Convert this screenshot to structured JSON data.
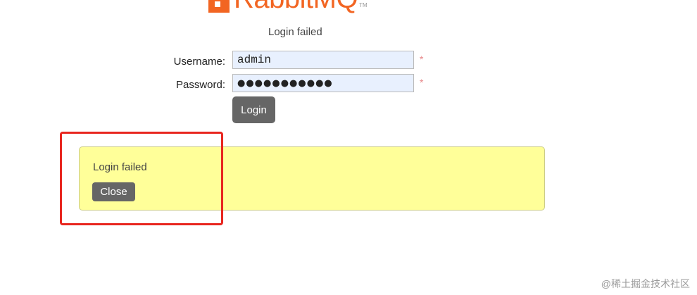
{
  "logo": {
    "text": "RabbitMQ",
    "tm": "TM",
    "brand_color": "#f26522"
  },
  "status": {
    "title": "Login failed"
  },
  "form": {
    "username_label": "Username:",
    "username_value": "admin",
    "password_label": "Password:",
    "password_value": "●●●●●●●●●●●",
    "required_marker": "*",
    "login_label": "Login"
  },
  "alert": {
    "message": "Login failed",
    "close_label": "Close",
    "background": "#ffff99"
  },
  "annotation": {
    "highlight_color": "#e8261f"
  },
  "watermark": {
    "text": "@稀土掘金技术社区"
  }
}
